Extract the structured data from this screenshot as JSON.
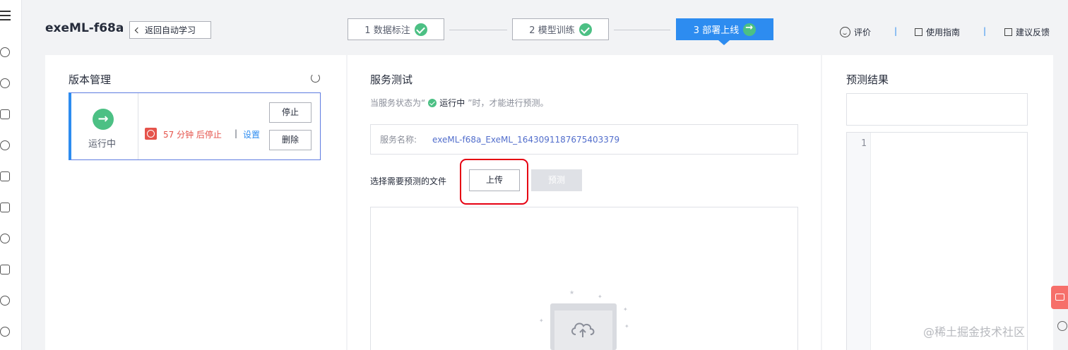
{
  "header": {
    "project_name": "exeML-f68a",
    "back_label": "返回自动学习",
    "steps": [
      {
        "label": "1 数据标注",
        "state": "done"
      },
      {
        "label": "2 模型训练",
        "state": "done"
      },
      {
        "label": "3 部署上线",
        "state": "active"
      }
    ],
    "links": {
      "rate": "评价",
      "guide": "使用指南",
      "feedback": "建议反馈",
      "separator": "|"
    }
  },
  "version_panel": {
    "title": "版本管理",
    "status": "运行中",
    "timer_text": "57 分钟 后停止",
    "separator": "|",
    "settings_link": "设置",
    "stop_button": "停止",
    "delete_button": "删除"
  },
  "service_test": {
    "title": "服务测试",
    "hint_prefix": "当服务状态为“",
    "hint_status": "运行中",
    "hint_suffix": "”时，才能进行预测。",
    "service_name_label": "服务名称:",
    "service_name_value": "exeML-f68a_ExeML_1643091187675403379",
    "select_file_label": "选择需要预测的文件",
    "upload_button": "上传",
    "predict_button": "预测"
  },
  "result_panel": {
    "title": "预测结果",
    "line_number": "1"
  },
  "watermark": "@稀土掘金技术社区",
  "colors": {
    "primary": "#2d8cf0",
    "success": "#4cc084",
    "danger": "#e5534b",
    "highlight": "#e60012"
  }
}
